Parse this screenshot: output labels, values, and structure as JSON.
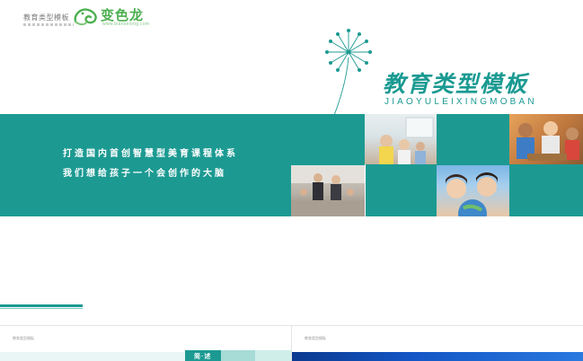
{
  "header": {
    "left_logo_text": "教育类型模板",
    "brand_name": "变色龙",
    "brand_url": "www.bianselong.com"
  },
  "hero": {
    "title": "教育类型模板",
    "subtitle": "JIAOYULEIXINGMOBAN"
  },
  "band": {
    "line1": "打造国内首创智慧型美育课程体系",
    "line2": "我们想给孩子一个会创作的大脑"
  },
  "thumbnails": [
    {
      "label": "教育类型模板",
      "block_text": "简·述"
    },
    {
      "label": "教育类型模板"
    }
  ],
  "colors": {
    "accent": "#1c9a92",
    "brand_green": "#4caf50"
  },
  "icons": [
    "chameleon-logo-icon",
    "dandelion-icon"
  ]
}
